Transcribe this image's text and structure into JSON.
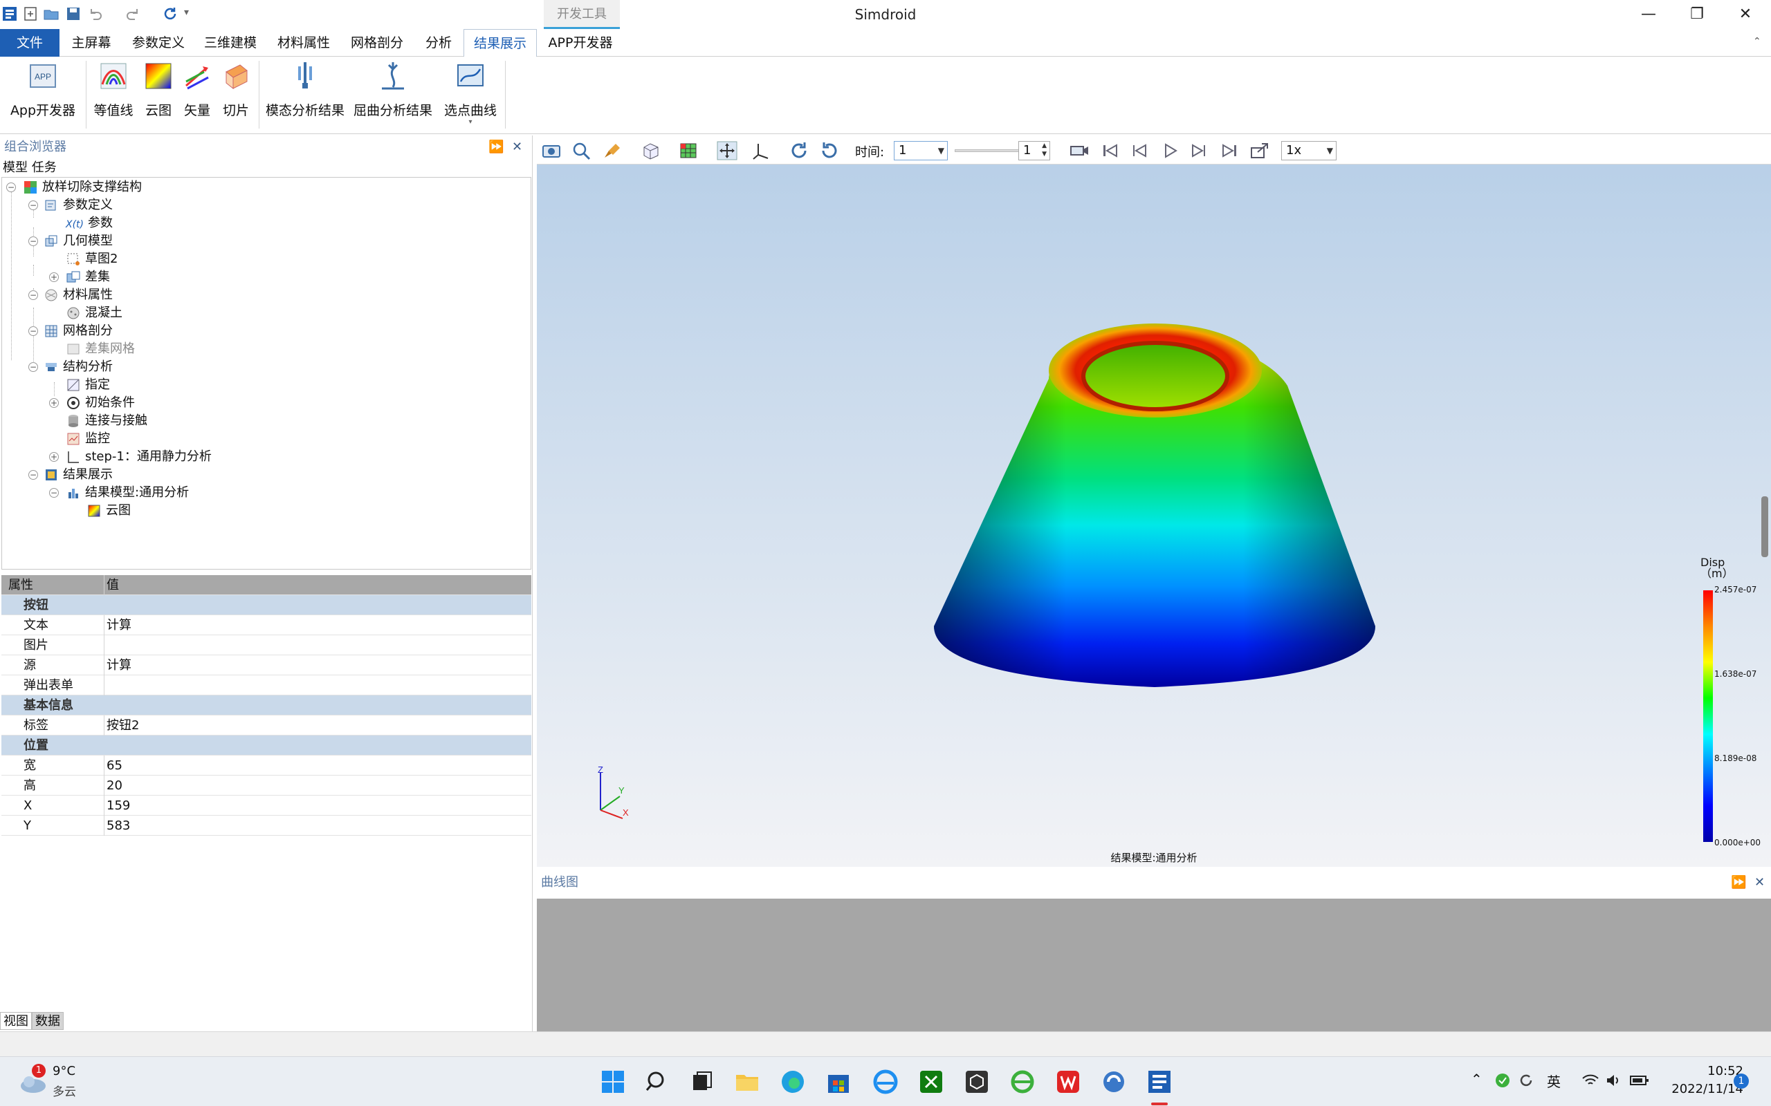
{
  "window": {
    "title": "Simdroid",
    "contextual_tab": "开发工具"
  },
  "menu": {
    "tabs": [
      "文件",
      "主屏幕",
      "参数定义",
      "三维建模",
      "材料属性",
      "网格剖分",
      "分析",
      "结果展示",
      "APP开发器"
    ],
    "active": "结果展示"
  },
  "ribbon": {
    "buttons": [
      "App开发器",
      "等值线",
      "云图",
      "矢量",
      "切片",
      "模态分析结果",
      "屈曲分析结果",
      "选点曲线"
    ]
  },
  "browser": {
    "title": "组合浏览器",
    "tabs": "模型 任务",
    "tree": [
      {
        "label": "放样切除支撑结构",
        "icon": "model-icon"
      },
      {
        "label": "参数定义",
        "icon": "parameter-definition-icon"
      },
      {
        "label": "参数",
        "icon": "parameter-icon"
      },
      {
        "label": "几何模型",
        "icon": "geometry-icon"
      },
      {
        "label": "草图2",
        "icon": "sketch-icon"
      },
      {
        "label": "差集",
        "icon": "difference-icon"
      },
      {
        "label": "材料属性",
        "icon": "material-icon"
      },
      {
        "label": "混凝土",
        "icon": "concrete-icon"
      },
      {
        "label": "网格剖分",
        "icon": "mesh-icon"
      },
      {
        "label": "差集网格",
        "icon": "mesh-item-icon"
      },
      {
        "label": "结构分析",
        "icon": "analysis-icon"
      },
      {
        "label": "指定",
        "icon": "assign-icon"
      },
      {
        "label": "初始条件",
        "icon": "initial-condition-icon"
      },
      {
        "label": "连接与接触",
        "icon": "contact-icon"
      },
      {
        "label": "监控",
        "icon": "monitor-icon"
      },
      {
        "label": "step-1：通用静力分析",
        "icon": "step-icon"
      },
      {
        "label": "结果展示",
        "icon": "results-icon"
      },
      {
        "label": "结果模型:通用分析",
        "icon": "result-model-icon"
      },
      {
        "label": "云图",
        "icon": "contour-icon"
      }
    ]
  },
  "properties": {
    "header_key": "属性",
    "header_value": "值",
    "rows": [
      {
        "type": "cat",
        "key": "按钮",
        "value": ""
      },
      {
        "type": "row",
        "key": "文本",
        "value": "计算"
      },
      {
        "type": "row",
        "key": "图片",
        "value": ""
      },
      {
        "type": "row",
        "key": "源",
        "value": "计算"
      },
      {
        "type": "row",
        "key": "弹出表单",
        "value": ""
      },
      {
        "type": "cat",
        "key": "基本信息",
        "value": ""
      },
      {
        "type": "row",
        "key": "标签",
        "value": "按钮2"
      },
      {
        "type": "cat",
        "key": "位置",
        "value": ""
      },
      {
        "type": "row",
        "key": "宽",
        "value": "65"
      },
      {
        "type": "row",
        "key": "高",
        "value": "20"
      },
      {
        "type": "row",
        "key": "X",
        "value": "159"
      },
      {
        "type": "row",
        "key": "Y",
        "value": "583"
      }
    ]
  },
  "bottom_tabs": [
    "视图",
    "数据"
  ],
  "viewport_toolbar": {
    "time_label": "时间:",
    "time_value": "1",
    "frame_value": "1",
    "speed": "1x"
  },
  "viewport": {
    "model_label": "结果模型:通用分析",
    "axes": {
      "x": "X",
      "y": "Y",
      "z": "Z"
    },
    "legend": {
      "title": "Disp",
      "unit": "（m）",
      "values": [
        "2.457e-07",
        "1.638e-07",
        "8.189e-08",
        "0.000e+00"
      ],
      "colors": [
        "#ff0000",
        "#00ff00",
        "#00ffff",
        "#0000ff"
      ]
    }
  },
  "curve_panel": {
    "title": "曲线图"
  },
  "taskbar": {
    "weather_temp": "9°C",
    "weather_desc": "多云",
    "weather_badge": "1",
    "ime": "英",
    "time": "10:52",
    "date": "2022/11/14",
    "notification_count": "1"
  }
}
